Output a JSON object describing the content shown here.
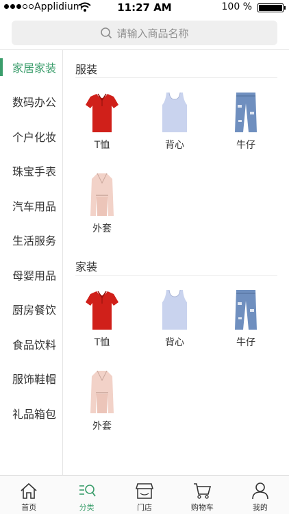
{
  "status_bar": {
    "carrier": "Applidium",
    "time": "11:27 AM",
    "battery": "100 %"
  },
  "search": {
    "placeholder": "请输入商品名称",
    "icon": "search-icon"
  },
  "sidebar": {
    "items": [
      {
        "label": "家居家装",
        "active": true
      },
      {
        "label": "数码办公"
      },
      {
        "label": "个户化妆"
      },
      {
        "label": "珠宝手表"
      },
      {
        "label": "汽车用品"
      },
      {
        "label": "生活服务"
      },
      {
        "label": "母婴用品"
      },
      {
        "label": "厨房餐饮"
      },
      {
        "label": "食品饮料"
      },
      {
        "label": "服饰鞋帽"
      },
      {
        "label": "礼品箱包"
      }
    ]
  },
  "sections": [
    {
      "title": "服装",
      "products": [
        {
          "label": "T恤",
          "icon": "tshirt-icon"
        },
        {
          "label": "背心",
          "icon": "tank-top-icon"
        },
        {
          "label": "牛仔",
          "icon": "jeans-icon"
        },
        {
          "label": "外套",
          "icon": "coat-icon"
        }
      ]
    },
    {
      "title": "家装",
      "products": [
        {
          "label": "T恤",
          "icon": "tshirt-icon"
        },
        {
          "label": "背心",
          "icon": "tank-top-icon"
        },
        {
          "label": "牛仔",
          "icon": "jeans-icon"
        },
        {
          "label": "外套",
          "icon": "coat-icon"
        }
      ]
    }
  ],
  "tab_bar": {
    "tabs": [
      {
        "label": "首页",
        "icon": "home-icon"
      },
      {
        "label": "分类",
        "icon": "category-search-icon",
        "active": true
      },
      {
        "label": "门店",
        "icon": "store-icon"
      },
      {
        "label": "购物车",
        "icon": "cart-icon"
      },
      {
        "label": "我的",
        "icon": "user-icon"
      }
    ]
  },
  "colors": {
    "accent": "#3a9d6b",
    "tshirt": "#d0201a",
    "tank": "#c9d3ee",
    "jeans": "#6f8fbf",
    "coat": "#f2d2c8"
  }
}
